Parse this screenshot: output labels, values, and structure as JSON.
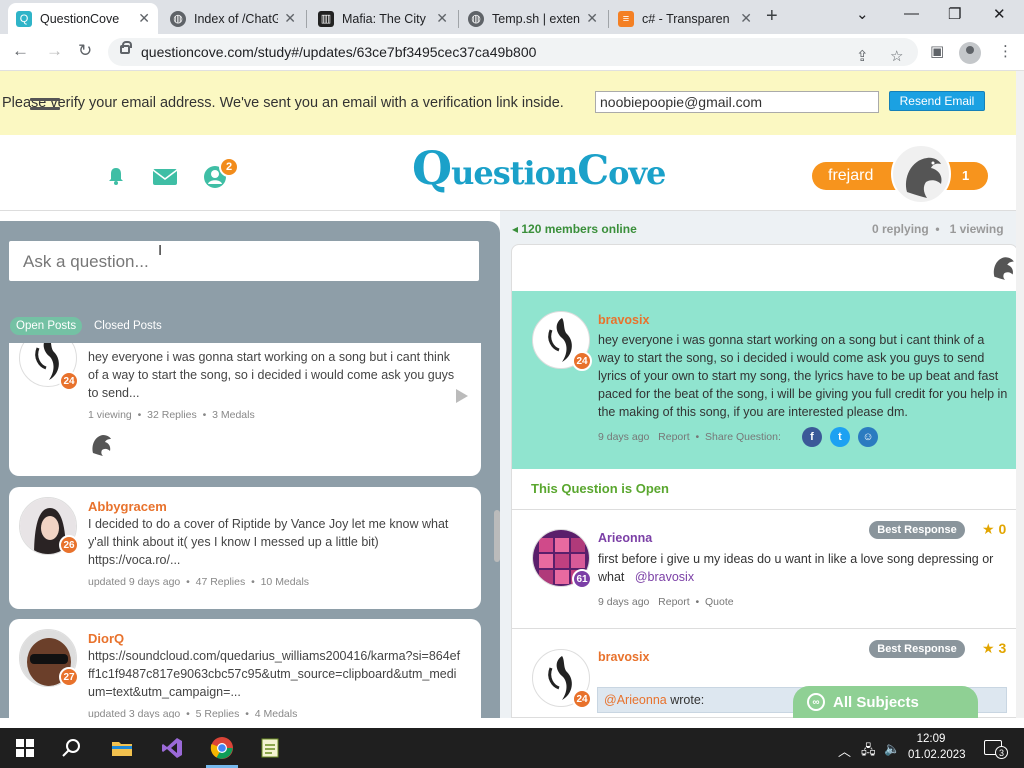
{
  "browser": {
    "tabs": [
      {
        "title": "QuestionCove"
      },
      {
        "title": "Index of /ChatG"
      },
      {
        "title": "Mafia: The City"
      },
      {
        "title": "Temp.sh | exten"
      },
      {
        "title": "c# - Transparen"
      }
    ],
    "url": "questioncove.com/study#/updates/63ce7bf3495cec37ca49b800"
  },
  "banner": {
    "text": "Please verify your email address. We've sent you an email with a verification link inside.",
    "email": "noobiepoopie@gmail.com",
    "resend_label": "Resend Email"
  },
  "header": {
    "friends_badge": "2",
    "logo_text_q": "Q",
    "logo_text_1": "uestion",
    "logo_text_c": "C",
    "logo_text_2": "ove",
    "username": "frejard",
    "user_count": "1"
  },
  "left": {
    "ask_placeholder": "Ask a question...",
    "filter_open": "Open Posts",
    "filter_closed": "Closed Posts",
    "posts": [
      {
        "level": "24",
        "text": "hey everyone i was gonna start working on a song but i cant think of a way to start the song, so i decided i would come ask you guys to send...",
        "meta_a": "1 viewing",
        "meta_b": "32 Replies",
        "meta_c": "3 Medals"
      },
      {
        "name": "Abbygracem",
        "level": "26",
        "text": "I decided to do a cover of Riptide by Vance Joy let me know what y'all think about it( yes I know I messed up a little bit) https://voca.ro/...",
        "meta_a": "updated 9 days ago",
        "meta_b": "47 Replies",
        "meta_c": "10 Medals"
      },
      {
        "name": "DiorQ",
        "level": "27",
        "text": "https://soundcloud.com/quedarius_williams200416/karma?si=864efff1c1f9487c817e9063cbc57c95&utm_source=clipboard&utm_medium=text&utm_campaign=...",
        "meta_a": "updated 3 days ago",
        "meta_b": "5 Replies",
        "meta_c": "4 Medals"
      }
    ]
  },
  "right": {
    "online": "120 members online",
    "replying": "0 replying",
    "viewing": "1 viewing",
    "question": {
      "name": "bravosix",
      "level": "24",
      "text": "hey everyone i was gonna start working on a song but i cant think of a way to start the song, so i decided i would come ask you guys to send lyrics of your own to start my song, the lyrics have to be up beat and fast paced for the beat of the song, i will be giving you full credit for you help in the making of this song, if you are interested please dm.",
      "time": "9 days ago",
      "report": "Report",
      "share": "Share Question:"
    },
    "open_label": "This Question is Open",
    "replies": [
      {
        "name": "Arieonna",
        "level": "61",
        "text": "first before i give u my ideas do u want in like a love song depressing or what",
        "mention": "@bravosix",
        "time": "9 days ago",
        "report": "Report",
        "quote": "Quote",
        "best": "Best Response",
        "medals": "0"
      },
      {
        "name": "bravosix",
        "level": "24",
        "quote_user": "@Arieonna",
        "quote_wrote": "wrote:",
        "best": "Best Response",
        "medals": "3"
      }
    ],
    "all_subjects": "All Subjects"
  },
  "taskbar": {
    "time": "12:09",
    "date": "01.02.2023",
    "notifications": "3"
  }
}
